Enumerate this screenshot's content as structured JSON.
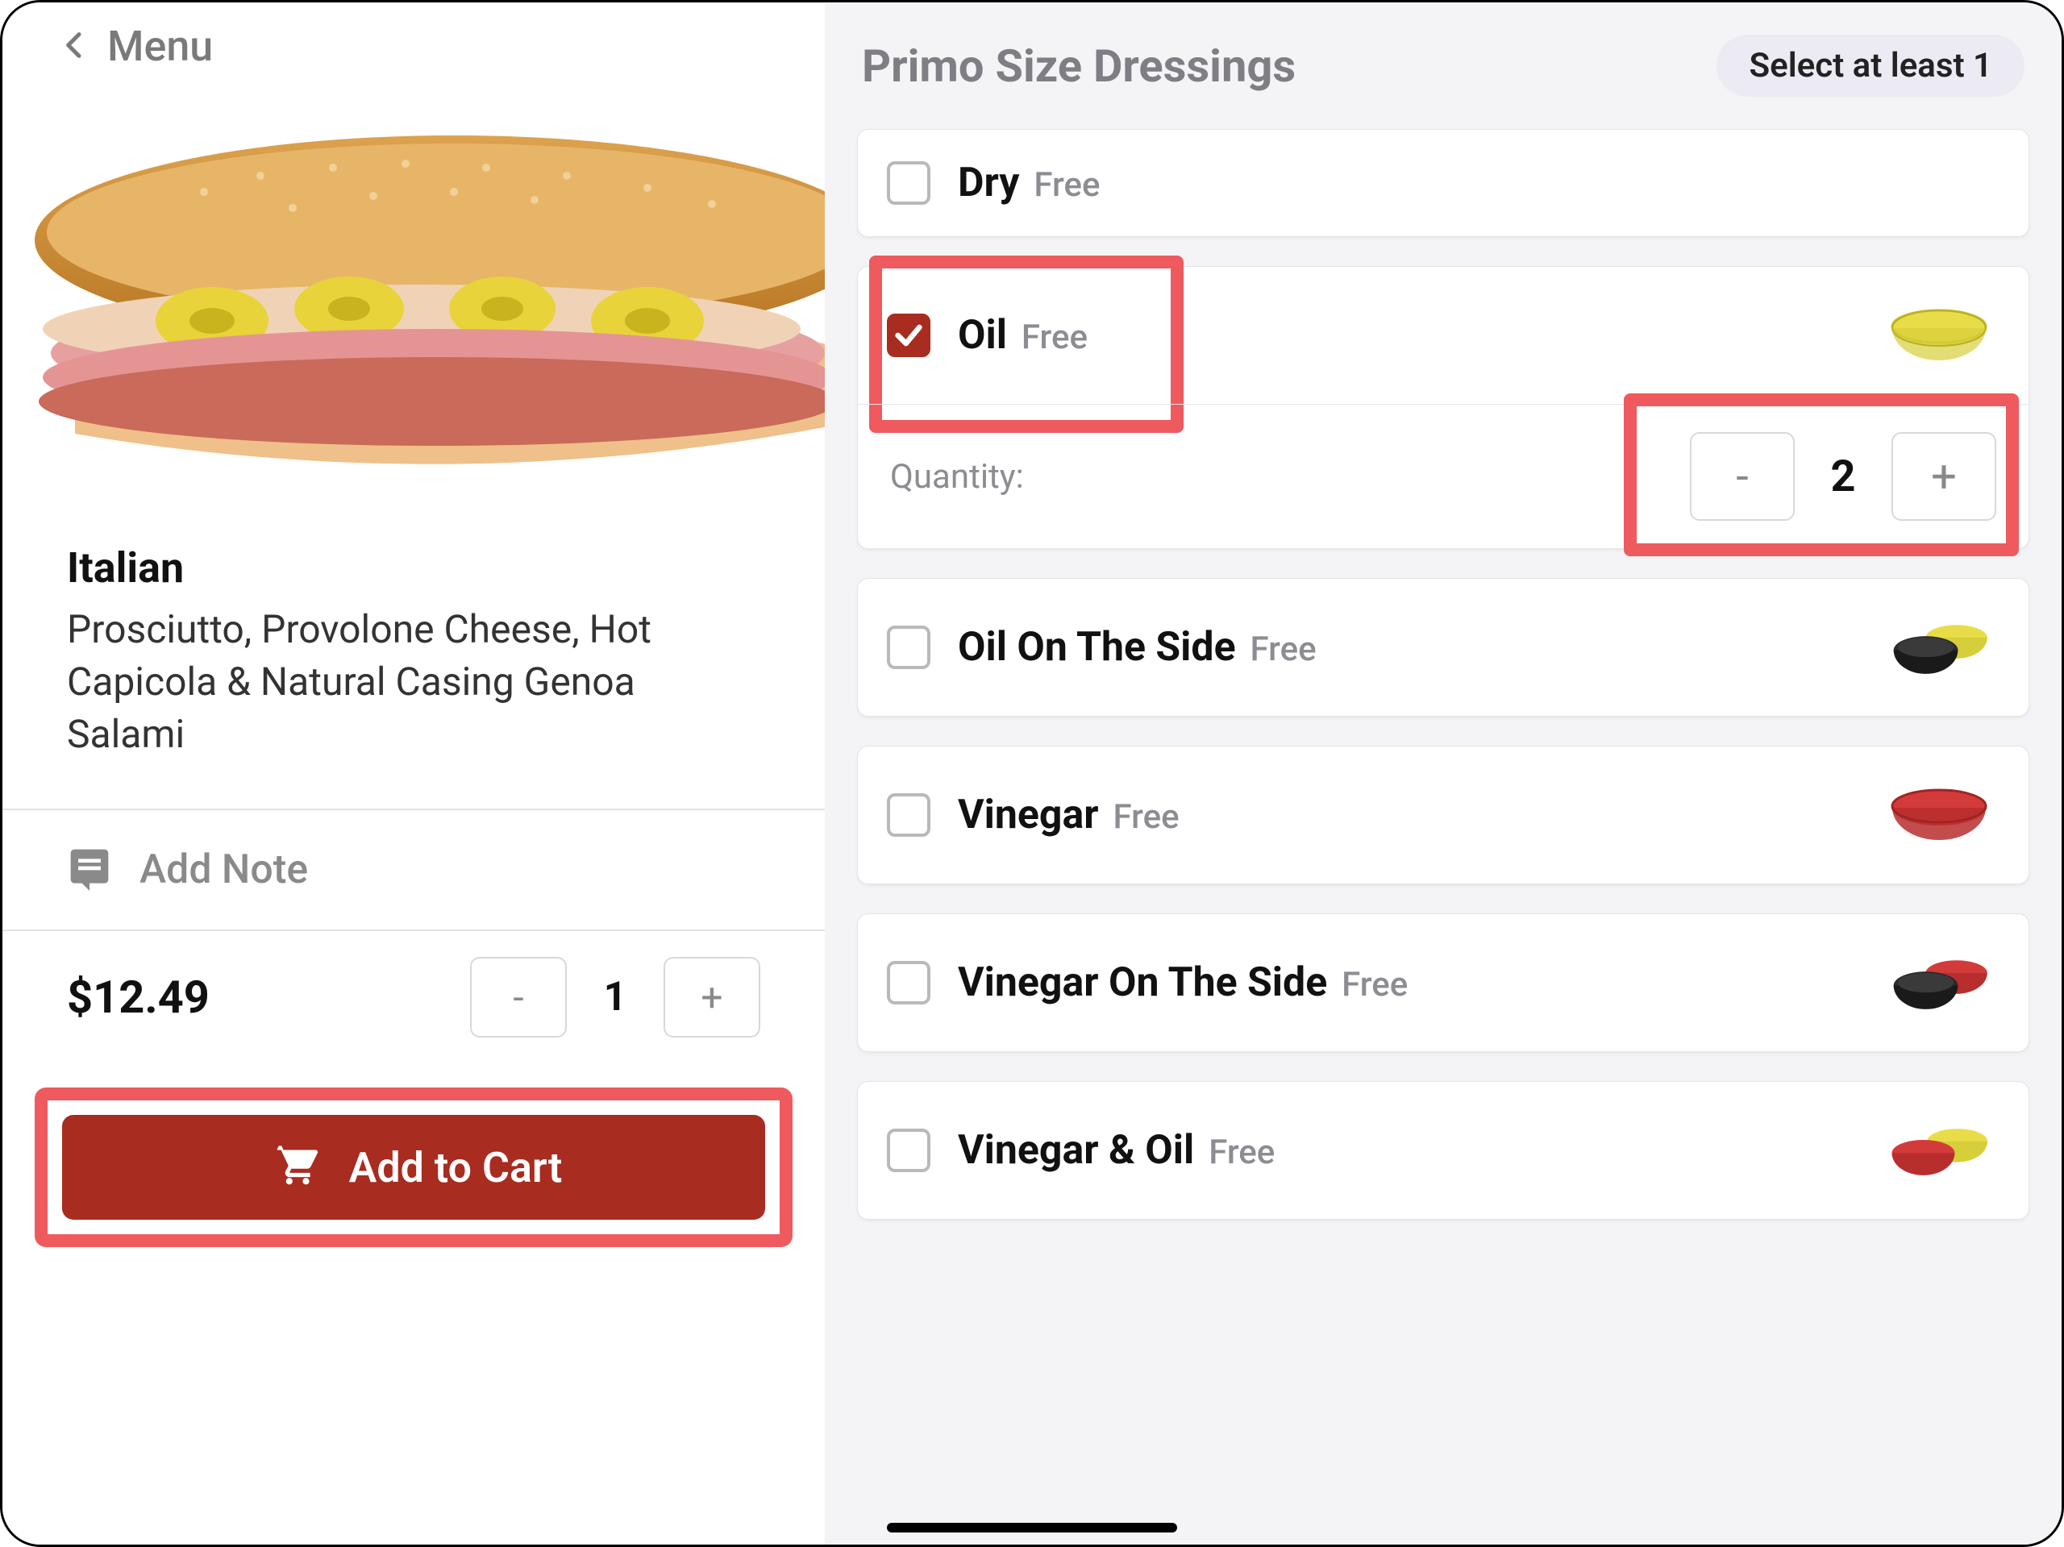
{
  "back_label": "Menu",
  "product": {
    "title": "Italian",
    "description": "Prosciutto, Provolone Cheese, Hot Capicola & Natural Casing Genoa Salami",
    "price": "$12.49",
    "quantity": "1"
  },
  "add_note_label": "Add Note",
  "add_to_cart_label": "Add to Cart",
  "section": {
    "title": "Primo Size Dressings",
    "requirement": "Select at least 1"
  },
  "options": {
    "dry": {
      "label": "Dry",
      "price": "Free",
      "checked": false
    },
    "oil": {
      "label": "Oil",
      "price": "Free",
      "checked": true,
      "quantity_label": "Quantity:",
      "quantity": "2"
    },
    "oil_side": {
      "label": "Oil On The Side",
      "price": "Free",
      "checked": false
    },
    "vinegar": {
      "label": "Vinegar",
      "price": "Free",
      "checked": false
    },
    "vin_side": {
      "label": "Vinegar On The Side",
      "price": "Free",
      "checked": false
    },
    "vin_oil": {
      "label": "Vinegar & Oil",
      "price": "Free",
      "checked": false
    }
  },
  "highlights": {
    "oil_option": true,
    "oil_quantity": true,
    "add_to_cart": true
  }
}
